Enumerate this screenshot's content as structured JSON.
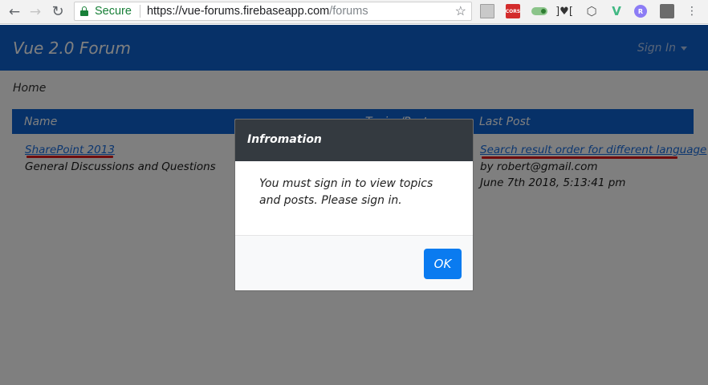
{
  "browser": {
    "secure_label": "Secure",
    "url_host": "https://vue-forums.firebaseapp.com",
    "url_path": "/forums",
    "extensions": [
      "page-icon",
      "cors-extension-icon",
      "toggle-extension-icon",
      "bracket-heart-extension-icon",
      "hexagon-extension-icon",
      "vue-devtools-icon",
      "r-extension-icon",
      "shield-extension-icon",
      "menu-icon"
    ],
    "cors_label": "CORS",
    "r_label": "R"
  },
  "app": {
    "brand": "Vue 2.0 Forum",
    "signin_label": "Sign In",
    "breadcrumb": "Home",
    "table": {
      "headers": {
        "name": "Name",
        "topics": "Topics/Posts",
        "last_post": "Last Post"
      },
      "rows": [
        {
          "forum_name": "SharePoint 2013",
          "forum_description": "General Discussions and Questions",
          "last_post_title": "Search result order for different language",
          "last_post_author": "by robert@gmail.com",
          "last_post_date": "June 7th 2018, 5:13:41 pm"
        }
      ]
    }
  },
  "modal": {
    "title": "Infromation",
    "body": "You must sign in to view topics and posts. Please sign in.",
    "ok_label": "OK"
  },
  "colors": {
    "navbar": "#0e62d0",
    "modal_header": "#343a40",
    "ok_button": "#0a7bf0",
    "annotation_underline": "#e11b1b"
  }
}
